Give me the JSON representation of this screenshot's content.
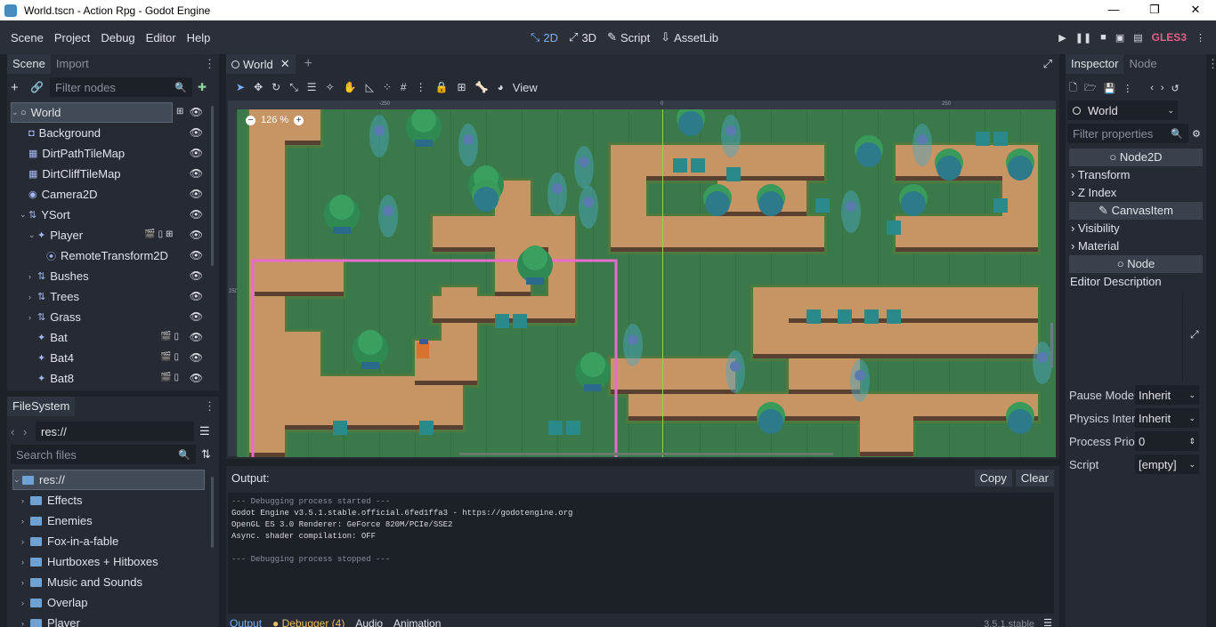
{
  "window": {
    "title": "World.tscn - Action Rpg - Godot Engine",
    "controls": [
      "—",
      "❐",
      "✕"
    ]
  },
  "menu": {
    "items": [
      "Scene",
      "Project",
      "Debug",
      "Editor",
      "Help"
    ]
  },
  "workspaces": [
    {
      "label": "2D",
      "icon": "2d-icon"
    },
    {
      "label": "3D",
      "icon": "3d-icon"
    },
    {
      "label": "Script",
      "icon": "script-icon"
    },
    {
      "label": "AssetLib",
      "icon": "assetlib-icon"
    }
  ],
  "renderer": "GLES3",
  "scene_dock": {
    "tabs": [
      "Scene",
      "Import"
    ],
    "filter_placeholder": "Filter nodes",
    "nodes": [
      {
        "name": "World",
        "indent": 0,
        "expanded": true,
        "type": "node"
      },
      {
        "name": "Background",
        "indent": 1,
        "type": "sprite"
      },
      {
        "name": "DirtPathTileMap",
        "indent": 1,
        "type": "tilemap"
      },
      {
        "name": "DirtCliffTileMap",
        "indent": 1,
        "type": "tilemap"
      },
      {
        "name": "Camera2D",
        "indent": 1,
        "type": "camera"
      },
      {
        "name": "YSort",
        "indent": 1,
        "expanded": true,
        "type": "ysort"
      },
      {
        "name": "Player",
        "indent": 2,
        "expanded": true,
        "type": "instance"
      },
      {
        "name": "RemoteTransform2D",
        "indent": 3,
        "type": "remote"
      },
      {
        "name": "Bushes",
        "indent": 2,
        "collapsed": true,
        "type": "ysort"
      },
      {
        "name": "Trees",
        "indent": 2,
        "collapsed": true,
        "type": "ysort"
      },
      {
        "name": "Grass",
        "indent": 2,
        "collapsed": true,
        "type": "ysort"
      },
      {
        "name": "Bat",
        "indent": 2,
        "type": "instance"
      },
      {
        "name": "Bat4",
        "indent": 2,
        "type": "instance"
      },
      {
        "name": "Bat8",
        "indent": 2,
        "type": "instance"
      }
    ]
  },
  "filesystem_dock": {
    "tab": "FileSystem",
    "path": "res://",
    "search_placeholder": "Search files",
    "items": [
      "res://",
      "Effects",
      "Enemies",
      "Fox-in-a-fable",
      "Hurtboxes + Hitboxes",
      "Music and Sounds",
      "Overlap",
      "Player"
    ]
  },
  "viewport": {
    "scene_tab": "World",
    "zoom": "126 %",
    "view_menu": "View",
    "ruler_marks": [
      "-250",
      "0",
      "250"
    ],
    "side_ruler": "250"
  },
  "output": {
    "title": "Output:",
    "copy_label": "Copy",
    "clear_label": "Clear",
    "lines": [
      "--- Debugging process started ---",
      "Godot Engine v3.5.1.stable.official.6fed1ffa3 - https://godotengine.org",
      "OpenGL ES 3.0 Renderer: GeForce 820M/PCIe/SSE2",
      "Async. shader compilation: OFF",
      "",
      "--- Debugging process stopped ---"
    ],
    "bottom_tabs": [
      "Output",
      "Debugger (4)",
      "Audio",
      "Animation"
    ],
    "version": "3.5.1.stable"
  },
  "inspector": {
    "tabs": [
      "Inspector",
      "Node"
    ],
    "object": "World",
    "filter_placeholder": "Filter properties",
    "sections": {
      "node2d": "Node2D",
      "transform": "Transform",
      "z_index": "Z Index",
      "canvas_item": "CanvasItem",
      "visibility": "Visibility",
      "material": "Material",
      "node": "Node",
      "editor_description": "Editor Description"
    },
    "properties": [
      {
        "label": "Pause Mode",
        "value": "Inherit"
      },
      {
        "label": "Physics Inter",
        "value": "Inherit"
      },
      {
        "label": "Process Prio",
        "value": "0"
      },
      {
        "label": "Script",
        "value": "[empty]"
      }
    ]
  },
  "colors": {
    "accent": "#7ab0ff",
    "gles": "#e15f88",
    "grass": "#3a7a4a",
    "dirt": "#c79463",
    "cliff": "#5a4030",
    "camera_limit": "#e86bd0"
  }
}
